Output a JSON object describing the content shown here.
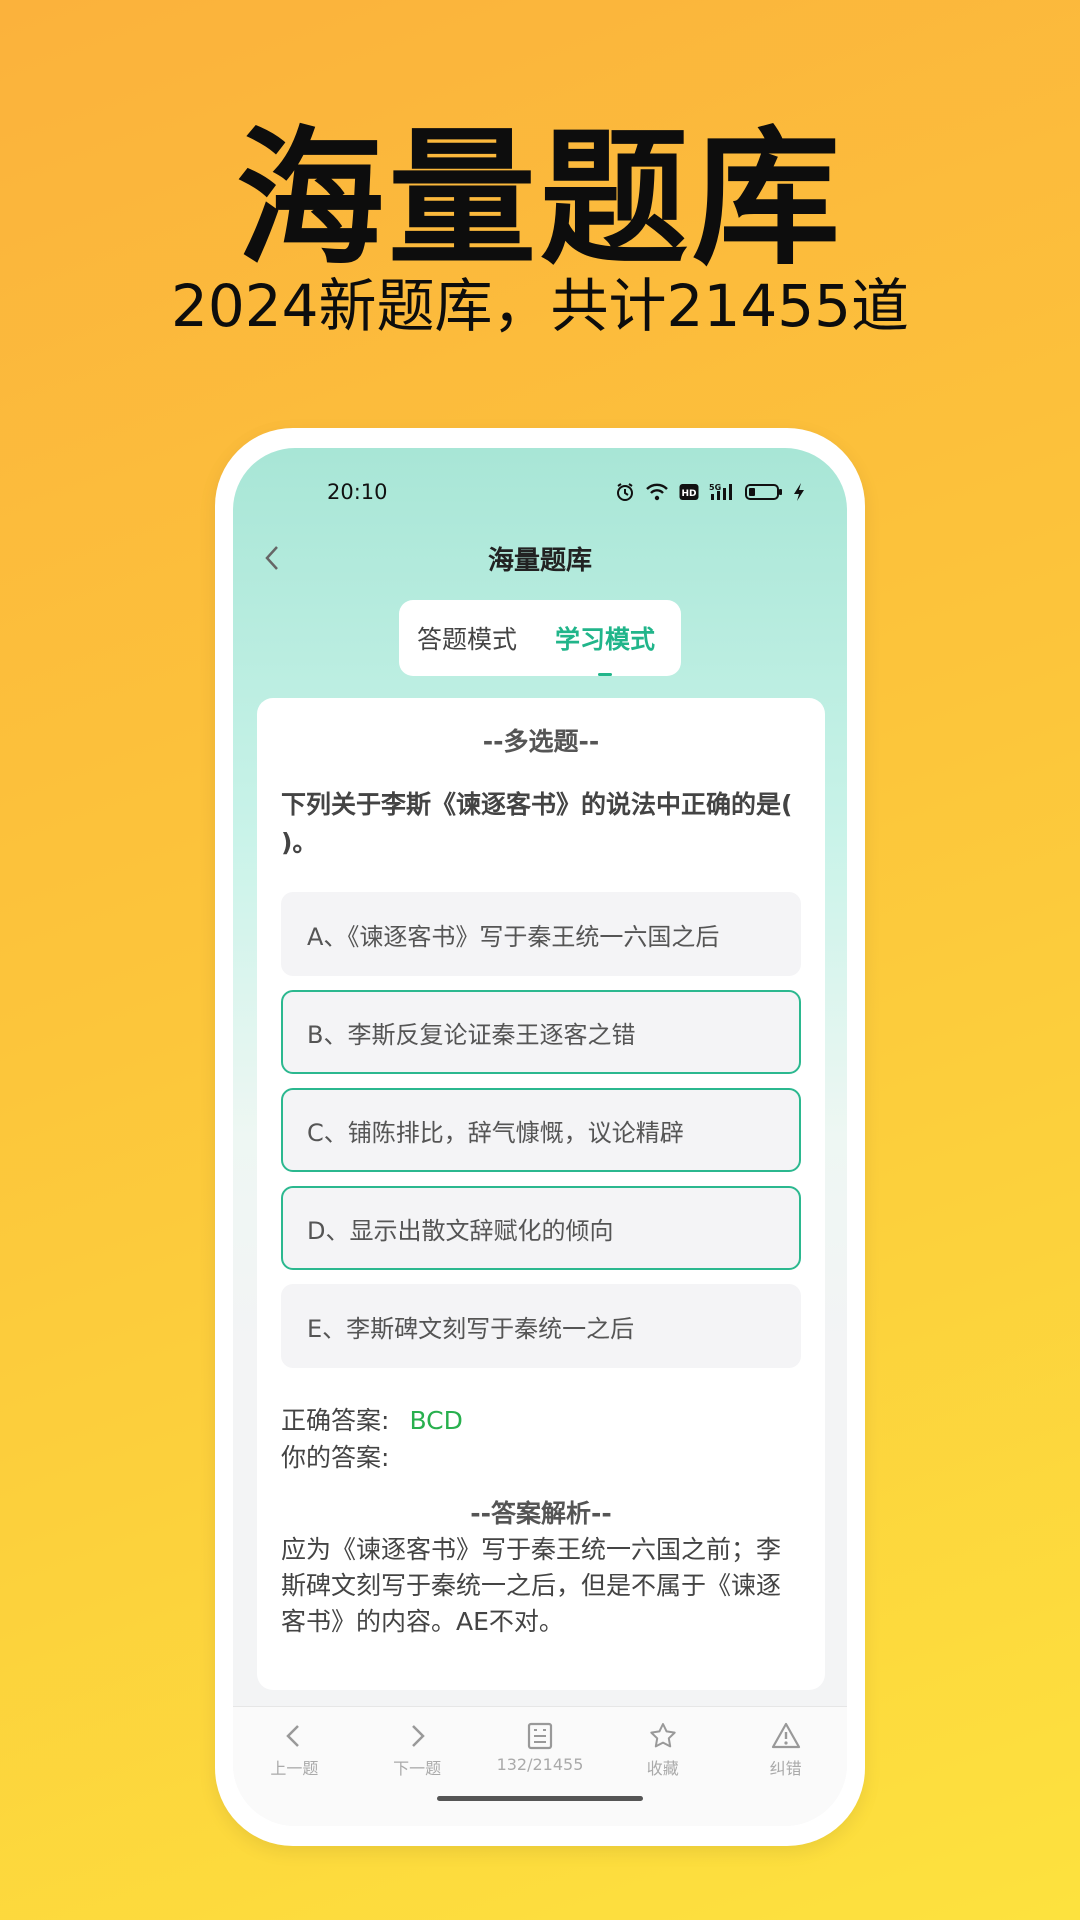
{
  "hero": {
    "title": "海量题库",
    "subtitle": "2024新题库，共计21455道"
  },
  "status_bar": {
    "time": "20:10",
    "icons": [
      "alarm-icon",
      "wifi-icon",
      "hd-icon",
      "5g-signal-icon",
      "battery-icon",
      "charging-icon"
    ]
  },
  "nav": {
    "title": "海量题库",
    "back_icon": "chevron-left-icon"
  },
  "mode_tabs": [
    {
      "label": "答题模式",
      "active": false
    },
    {
      "label": "学习模式",
      "active": true
    }
  ],
  "question": {
    "type": "--多选题--",
    "text": "下列关于李斯《谏逐客书》的说法中正确的是( )。",
    "options": [
      {
        "label": "A、《谏逐客书》写于秦王统一六国之后",
        "selected": false
      },
      {
        "label": "B、李斯反复论证秦王逐客之错",
        "selected": true
      },
      {
        "label": "C、铺陈排比，辞气慷慨，议论精辟",
        "selected": true
      },
      {
        "label": "D、显示出散文辞赋化的倾向",
        "selected": true
      },
      {
        "label": "E、李斯碑文刻写于秦统一之后",
        "selected": false
      }
    ],
    "correct_label": "正确答案:",
    "correct_value": "BCD",
    "yours_label": "你的答案:",
    "yours_value": "",
    "analysis_title": "--答案解析--",
    "analysis_text": "应为《谏逐客书》写于秦王统一六国之前；李斯碑文刻写于秦统一之后，但是不属于《谏逐客书》的内容。AE不对。"
  },
  "bottom_bar": [
    {
      "label": "上一题",
      "icon": "chevron-left-icon"
    },
    {
      "label": "下一题",
      "icon": "chevron-right-icon"
    },
    {
      "label": "132/21455",
      "icon": "answer-sheet-icon"
    },
    {
      "label": "收藏",
      "icon": "star-icon"
    },
    {
      "label": "纠错",
      "icon": "warning-icon"
    }
  ],
  "colors": {
    "accent": "#21b58a",
    "correct": "#28b04e",
    "background_top": "#fbb23c",
    "background_bottom": "#fde23e"
  }
}
